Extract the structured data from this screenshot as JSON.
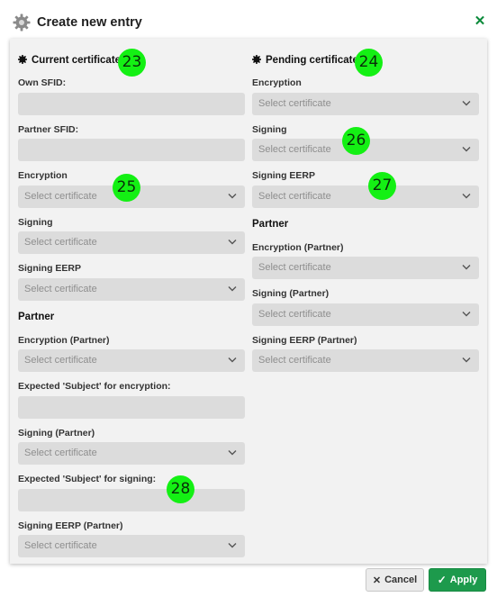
{
  "header": {
    "title": "Create new entry",
    "icon": "gear-icon",
    "close_icon": "close-icon",
    "accent": "#0a8a3a"
  },
  "current": {
    "title": "Current certificate",
    "own_sfid_label": "Own SFID:",
    "partner_sfid_label": "Partner SFID:",
    "encryption_label": "Encryption",
    "signing_label": "Signing",
    "signing_eerp_label": "Signing EERP",
    "partner_heading": "Partner",
    "enc_partner_label": "Encryption (Partner)",
    "subject_enc_label": "Expected 'Subject' for encryption:",
    "sign_partner_label": "Signing (Partner)",
    "subject_sign_label": "Expected 'Subject' for signing:",
    "eerp_partner_label": "Signing EERP (Partner)"
  },
  "pending": {
    "title": "Pending certificate",
    "encryption_label": "Encryption",
    "signing_label": "Signing",
    "signing_eerp_label": "Signing EERP",
    "partner_heading": "Partner",
    "enc_partner_label": "Encryption (Partner)",
    "sign_partner_label": "Signing (Partner)",
    "eerp_partner_label": "Signing EERP (Partner)"
  },
  "select_placeholder": "Select certificate",
  "annotations": {
    "a23": "23",
    "a24": "24",
    "a25": "25",
    "a26": "26",
    "a27": "27",
    "a28": "28"
  },
  "footer": {
    "cancel_label": "Cancel",
    "apply_label": "Apply",
    "apply_color": "#1d9a4c"
  }
}
